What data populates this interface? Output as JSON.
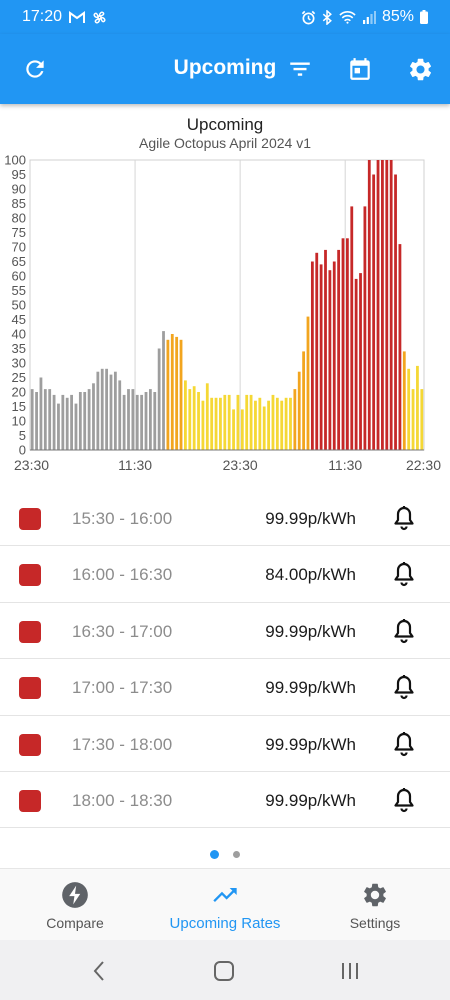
{
  "status_bar": {
    "time": "17:20",
    "battery": "85%",
    "left_icons": [
      "gmail-icon",
      "fan-icon"
    ],
    "right_icons": [
      "alarm-icon",
      "bluetooth-icon",
      "wifi-icon",
      "signal-icon",
      "battery-icon"
    ]
  },
  "app_bar": {
    "title": "Upcoming",
    "actions": [
      "refresh-icon",
      "filter-icon",
      "calendar-icon",
      "settings-icon"
    ],
    "color": "#2196f3"
  },
  "chart_data": {
    "type": "bar",
    "title": "Upcoming",
    "subtitle": "Agile Octopus April 2024 v1",
    "xlabel": "",
    "ylabel": "",
    "ylim": [
      0,
      100
    ],
    "y_ticks": [
      0,
      5,
      10,
      15,
      20,
      25,
      30,
      35,
      40,
      45,
      50,
      55,
      60,
      65,
      70,
      75,
      80,
      85,
      90,
      95,
      100
    ],
    "x_tick_labels": [
      "23:30",
      "11:30",
      "23:30",
      "11:30",
      "22:30"
    ],
    "x_tick_indices": [
      0,
      24,
      48,
      72,
      94
    ],
    "grid": true,
    "colors": {
      "grey": "#9e9e9e",
      "amber": "#f2a51f",
      "yellow": "#f5d835",
      "red": "#c62828"
    },
    "values": [
      21,
      20,
      25,
      21,
      21,
      19,
      16,
      19,
      18,
      19,
      16,
      20,
      20,
      21,
      23,
      27,
      28,
      28,
      26,
      27,
      24,
      19,
      21,
      21,
      19,
      19,
      20,
      21,
      20,
      35,
      41,
      38,
      40,
      39,
      38,
      24,
      21,
      22,
      20,
      17,
      23,
      18,
      18,
      18,
      19,
      19,
      14,
      19,
      14,
      19,
      19,
      17,
      18,
      15,
      17,
      19,
      18,
      17,
      18,
      18,
      21,
      27,
      34,
      46,
      65,
      68,
      64,
      69,
      62,
      65,
      69,
      73,
      73,
      84,
      59,
      61,
      84,
      100,
      95,
      100,
      100,
      100,
      100,
      95,
      71,
      34,
      28,
      21,
      29,
      21
    ],
    "color_keys": [
      "g",
      "g",
      "g",
      "g",
      "g",
      "g",
      "g",
      "g",
      "g",
      "g",
      "g",
      "g",
      "g",
      "g",
      "g",
      "g",
      "g",
      "g",
      "g",
      "g",
      "g",
      "g",
      "g",
      "g",
      "g",
      "g",
      "g",
      "g",
      "g",
      "g",
      "g",
      "a",
      "a",
      "a",
      "a",
      "y",
      "y",
      "y",
      "y",
      "y",
      "y",
      "y",
      "y",
      "y",
      "y",
      "y",
      "y",
      "y",
      "y",
      "y",
      "y",
      "y",
      "y",
      "y",
      "y",
      "y",
      "y",
      "y",
      "y",
      "y",
      "a",
      "a",
      "a",
      "a",
      "r",
      "r",
      "r",
      "r",
      "r",
      "r",
      "r",
      "r",
      "r",
      "r",
      "r",
      "r",
      "r",
      "r",
      "r",
      "r",
      "r",
      "r",
      "r",
      "r",
      "r",
      "a",
      "y",
      "y",
      "y",
      "y"
    ]
  },
  "rates": [
    {
      "time": "15:30 - 16:00",
      "price": "99.99p/kWh"
    },
    {
      "time": "16:00 - 16:30",
      "price": "84.00p/kWh"
    },
    {
      "time": "16:30 - 17:00",
      "price": "99.99p/kWh"
    },
    {
      "time": "17:00 - 17:30",
      "price": "99.99p/kWh"
    },
    {
      "time": "17:30 - 18:00",
      "price": "99.99p/kWh"
    },
    {
      "time": "18:00 - 18:30",
      "price": "99.99p/kWh"
    }
  ],
  "rate_swatch_color": "#c62828",
  "page_indicator": {
    "count": 2,
    "active": 0
  },
  "bottom_nav": {
    "items": [
      {
        "label": "Compare",
        "icon": "bolt-icon"
      },
      {
        "label": "Upcoming Rates",
        "icon": "trending-up-icon"
      },
      {
        "label": "Settings",
        "icon": "gear-icon"
      }
    ],
    "active": 1
  },
  "system_nav": [
    "back-icon",
    "home-icon",
    "recents-icon"
  ]
}
